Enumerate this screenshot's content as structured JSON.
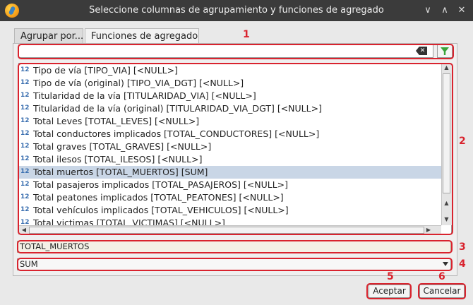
{
  "window": {
    "title": "Seleccione columnas de agrupamiento y funciones de agregado"
  },
  "tabs": [
    {
      "label": "Agrupar por..."
    },
    {
      "label": "Funciones de agregado"
    }
  ],
  "filter": {
    "value": ""
  },
  "fields": [
    {
      "type_badge": "12",
      "label": "Tipo de vía [TIPO_VIA]  [<NULL>]"
    },
    {
      "type_badge": "12",
      "label": "Tipo de vía (original) [TIPO_VIA_DGT]  [<NULL>]"
    },
    {
      "type_badge": "12",
      "label": "Titularidad de la vía [TITULARIDAD_VIA]  [<NULL>]"
    },
    {
      "type_badge": "12",
      "label": "Titularidad de la vía (original) [TITULARIDAD_VIA_DGT]  [<NULL>]"
    },
    {
      "type_badge": "12",
      "label": "Total Leves [TOTAL_LEVES]  [<NULL>]"
    },
    {
      "type_badge": "12",
      "label": "Total conductores implicados [TOTAL_CONDUCTORES]  [<NULL>]"
    },
    {
      "type_badge": "12",
      "label": "Total graves [TOTAL_GRAVES]  [<NULL>]"
    },
    {
      "type_badge": "12",
      "label": "Total ilesos [TOTAL_ILESOS]  [<NULL>]"
    },
    {
      "type_badge": "12",
      "label": "Total muertos [TOTAL_MUERTOS]  [SUM]",
      "selected": true
    },
    {
      "type_badge": "12",
      "label": "Total pasajeros implicados [TOTAL_PASAJEROS]  [<NULL>]"
    },
    {
      "type_badge": "12",
      "label": "Total peatones implicados [TOTAL_PEATONES]  [<NULL>]"
    },
    {
      "type_badge": "12",
      "label": "Total vehículos implicados [TOTAL_VEHICULOS]  [<NULL>]"
    },
    {
      "type_badge": "12",
      "label": "Total victimas [TOTAL_VICTIMAS]  [<NULL>]"
    }
  ],
  "selected_field": {
    "value": "TOTAL_MUERTOS"
  },
  "aggregate_function": {
    "value": "SUM"
  },
  "buttons": {
    "accept": "Aceptar",
    "cancel": "Cancelar"
  },
  "annotations": [
    "1",
    "2",
    "3",
    "4",
    "5",
    "6"
  ],
  "colors": {
    "annotation": "#d9232e",
    "selection": "#c9d6e6",
    "titlebar": "#3b3b3b"
  }
}
